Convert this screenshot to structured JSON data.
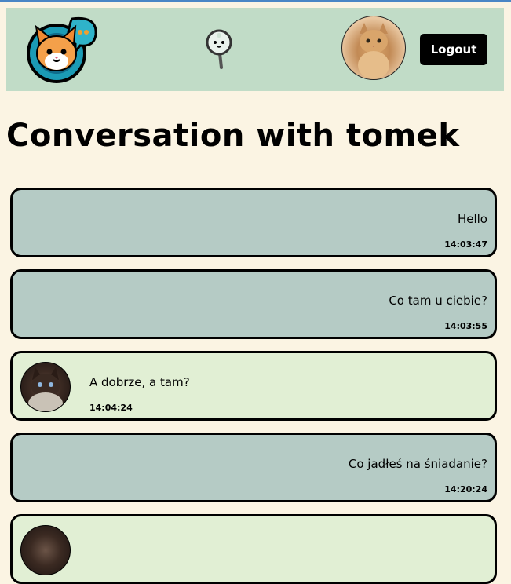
{
  "header": {
    "logo_icon": "cat-chat-logo-icon",
    "search_icon": "magnifier-icon",
    "avatar_icon": "user-avatar-cat",
    "logout_label": "Logout"
  },
  "page_title": "Conversation with tomek",
  "messages": [
    {
      "type": "sent",
      "text": "Hello",
      "time": "14:03:47"
    },
    {
      "type": "sent",
      "text": "Co tam u ciebie?",
      "time": "14:03:55"
    },
    {
      "type": "received",
      "text": "A dobrze, a tam?",
      "time": "14:04:24"
    },
    {
      "type": "sent",
      "text": "Co jadłeś na śniadanie?",
      "time": "14:20:24"
    }
  ],
  "colors": {
    "background": "#fbf4e3",
    "header": "#c1dcc7",
    "sent_bubble": "#b5cbc5",
    "received_bubble": "#e1efd4",
    "button": "#000000"
  }
}
